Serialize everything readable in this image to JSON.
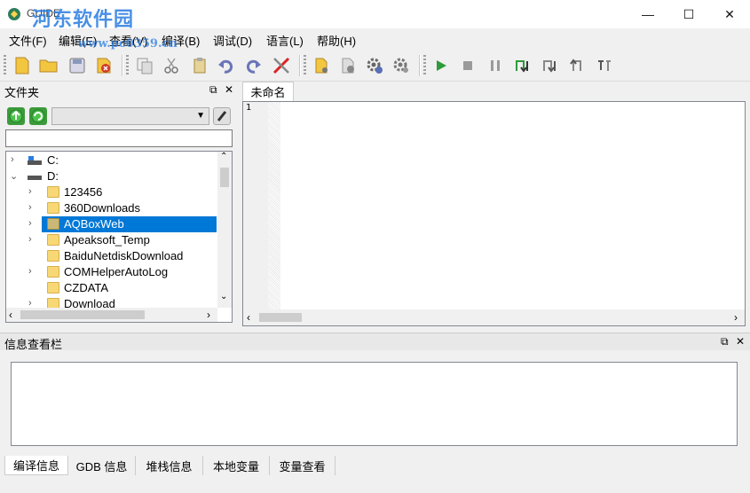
{
  "window": {
    "title": "GUIDE",
    "minimize": "—",
    "maximize": "☐",
    "close": "✕"
  },
  "watermark": {
    "text": "河东软件园",
    "url": "www.pc0359.cn"
  },
  "menu": [
    "文件(F)",
    "编辑(E)",
    "查看(V)",
    "编译(B)",
    "调试(D)",
    "语言(L)",
    "帮助(H)"
  ],
  "toolbar": {
    "buttons": [
      "new-file-icon",
      "open-folder-icon",
      "save-icon",
      "close-file-icon",
      "copy-icon",
      "cut-icon",
      "paste-icon",
      "undo-icon",
      "redo-icon",
      "tools-icon",
      "compile-icon",
      "build-icon",
      "settings-icon",
      "settings2-icon",
      "run-icon",
      "stop-icon",
      "pause-icon",
      "step-into-icon",
      "step-over-icon",
      "step-out-icon",
      "run-to-cursor-icon"
    ],
    "colors": {
      "run": "#2e9b3a",
      "stop": "#9a9a9a",
      "accent": "#0078d7"
    }
  },
  "file_panel": {
    "title": "文件夹",
    "combo_value": "",
    "path_value": "",
    "tree": [
      {
        "label": "C:",
        "type": "drive",
        "expanded": false
      },
      {
        "label": "D:",
        "type": "drive",
        "expanded": true
      },
      {
        "label": "123456",
        "type": "folder"
      },
      {
        "label": "360Downloads",
        "type": "folder"
      },
      {
        "label": "AQBoxWeb",
        "type": "folder",
        "selected": true
      },
      {
        "label": "Apeaksoft_Temp",
        "type": "folder"
      },
      {
        "label": "BaiduNetdiskDownload",
        "type": "folder"
      },
      {
        "label": "COMHelperAutoLog",
        "type": "folder"
      },
      {
        "label": "CZDATA",
        "type": "folder"
      },
      {
        "label": "Download",
        "type": "folder"
      }
    ]
  },
  "editor": {
    "tab_label": "未命名",
    "line_numbers": [
      "1"
    ]
  },
  "info_panel": {
    "title": "信息查看栏",
    "tabs": [
      "编译信息",
      "GDB 信息",
      "堆栈信息",
      "本地变量",
      "变量查看"
    ],
    "active_tab": 0
  }
}
